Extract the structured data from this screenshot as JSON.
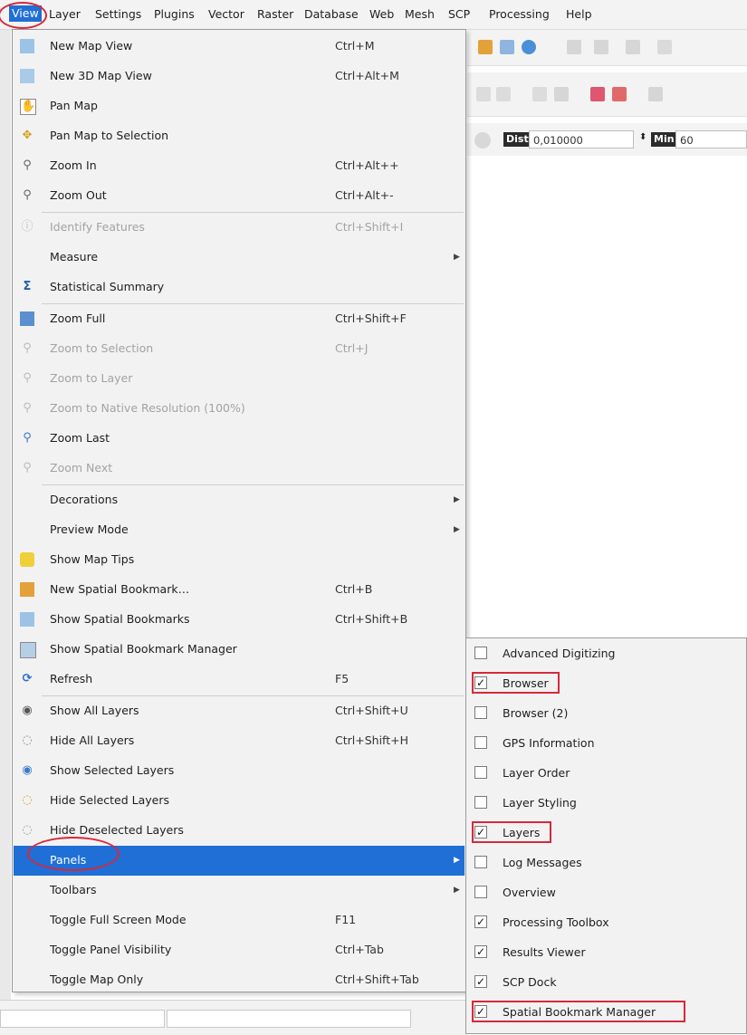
{
  "menubar": {
    "items": [
      {
        "label": "View",
        "active": true
      },
      {
        "label": "Layer"
      },
      {
        "label": "Settings"
      },
      {
        "label": "Plugins"
      },
      {
        "label": "Vector"
      },
      {
        "label": "Raster"
      },
      {
        "label": "Database"
      },
      {
        "label": "Web"
      },
      {
        "label": "Mesh"
      },
      {
        "label": "SCP"
      },
      {
        "label": "Processing"
      },
      {
        "label": "Help"
      }
    ]
  },
  "toolbar": {
    "dist_label": "Dist",
    "dist_value": "0,010000",
    "min_label": "Min",
    "min_value": "60"
  },
  "view_menu": {
    "items": [
      {
        "label": "New Map View",
        "shortcut": "Ctrl+M",
        "icon": "new-map-view-icon"
      },
      {
        "label": "New 3D Map View",
        "shortcut": "Ctrl+Alt+M",
        "icon": "new-3d-map-view-icon"
      },
      {
        "label": "Pan Map",
        "shortcut": "",
        "icon": "pan-hand-icon"
      },
      {
        "label": "Pan Map to Selection",
        "shortcut": "",
        "icon": "pan-to-selection-icon"
      },
      {
        "label": "Zoom In",
        "shortcut": "Ctrl+Alt++",
        "icon": "zoom-in-icon"
      },
      {
        "label": "Zoom Out",
        "shortcut": "Ctrl+Alt+-",
        "icon": "zoom-out-icon"
      },
      {
        "label": "Identify Features",
        "shortcut": "Ctrl+Shift+I",
        "icon": "identify-icon",
        "disabled": true
      },
      {
        "label": "Measure",
        "shortcut": "",
        "icon": "",
        "submenu": true
      },
      {
        "label": "Statistical Summary",
        "shortcut": "",
        "icon": "sigma-icon"
      },
      {
        "label": "Zoom Full",
        "shortcut": "Ctrl+Shift+F",
        "icon": "zoom-full-icon"
      },
      {
        "label": "Zoom to Selection",
        "shortcut": "Ctrl+J",
        "icon": "zoom-selection-icon",
        "disabled": true
      },
      {
        "label": "Zoom to Layer",
        "shortcut": "",
        "icon": "zoom-layer-icon",
        "disabled": true
      },
      {
        "label": "Zoom to Native Resolution (100%)",
        "shortcut": "",
        "icon": "zoom-native-icon",
        "disabled": true
      },
      {
        "label": "Zoom Last",
        "shortcut": "",
        "icon": "zoom-last-icon"
      },
      {
        "label": "Zoom Next",
        "shortcut": "",
        "icon": "zoom-next-icon",
        "disabled": true
      },
      {
        "label": "Decorations",
        "shortcut": "",
        "icon": "",
        "submenu": true
      },
      {
        "label": "Preview Mode",
        "shortcut": "",
        "icon": "",
        "submenu": true
      },
      {
        "label": "Show Map Tips",
        "shortcut": "",
        "icon": "map-tips-icon"
      },
      {
        "label": "New Spatial Bookmark…",
        "shortcut": "Ctrl+B",
        "icon": "new-bookmark-icon"
      },
      {
        "label": "Show Spatial Bookmarks",
        "shortcut": "Ctrl+Shift+B",
        "icon": "show-bookmarks-icon"
      },
      {
        "label": "Show Spatial Bookmark Manager",
        "shortcut": "",
        "icon": "bookmark-manager-icon"
      },
      {
        "label": "Refresh",
        "shortcut": "F5",
        "icon": "refresh-icon"
      },
      {
        "label": "Show All Layers",
        "shortcut": "Ctrl+Shift+U",
        "icon": "show-all-layers-icon"
      },
      {
        "label": "Hide All Layers",
        "shortcut": "Ctrl+Shift+H",
        "icon": "hide-all-layers-icon"
      },
      {
        "label": "Show Selected Layers",
        "shortcut": "",
        "icon": "show-selected-layers-icon"
      },
      {
        "label": "Hide Selected Layers",
        "shortcut": "",
        "icon": "hide-selected-layers-icon"
      },
      {
        "label": "Hide Deselected Layers",
        "shortcut": "",
        "icon": "hide-deselected-layers-icon"
      },
      {
        "label": "Panels",
        "shortcut": "",
        "icon": "",
        "submenu": true,
        "highlighted": true
      },
      {
        "label": "Toolbars",
        "shortcut": "",
        "icon": "",
        "submenu": true
      },
      {
        "label": "Toggle Full Screen Mode",
        "shortcut": "F11",
        "icon": ""
      },
      {
        "label": "Toggle Panel Visibility",
        "shortcut": "Ctrl+Tab",
        "icon": ""
      },
      {
        "label": "Toggle Map Only",
        "shortcut": "Ctrl+Shift+Tab",
        "icon": ""
      }
    ]
  },
  "panels_menu": {
    "items": [
      {
        "label": "Advanced Digitizing",
        "checked": false
      },
      {
        "label": "Browser",
        "checked": true,
        "boxed": true
      },
      {
        "label": "Browser (2)",
        "checked": false
      },
      {
        "label": "GPS Information",
        "checked": false
      },
      {
        "label": "Layer Order",
        "checked": false
      },
      {
        "label": "Layer Styling",
        "checked": false
      },
      {
        "label": "Layers",
        "checked": true,
        "boxed": true
      },
      {
        "label": "Log Messages",
        "checked": false
      },
      {
        "label": "Overview",
        "checked": false
      },
      {
        "label": "Processing Toolbox",
        "checked": true
      },
      {
        "label": "Results Viewer",
        "checked": true
      },
      {
        "label": "SCP Dock",
        "checked": true
      },
      {
        "label": "Spatial Bookmark Manager",
        "checked": true,
        "boxed": true
      }
    ]
  },
  "colors": {
    "highlight": "#1f6fd6",
    "annotation_red": "#d8283a",
    "menu_bg": "#f2f2f2"
  }
}
